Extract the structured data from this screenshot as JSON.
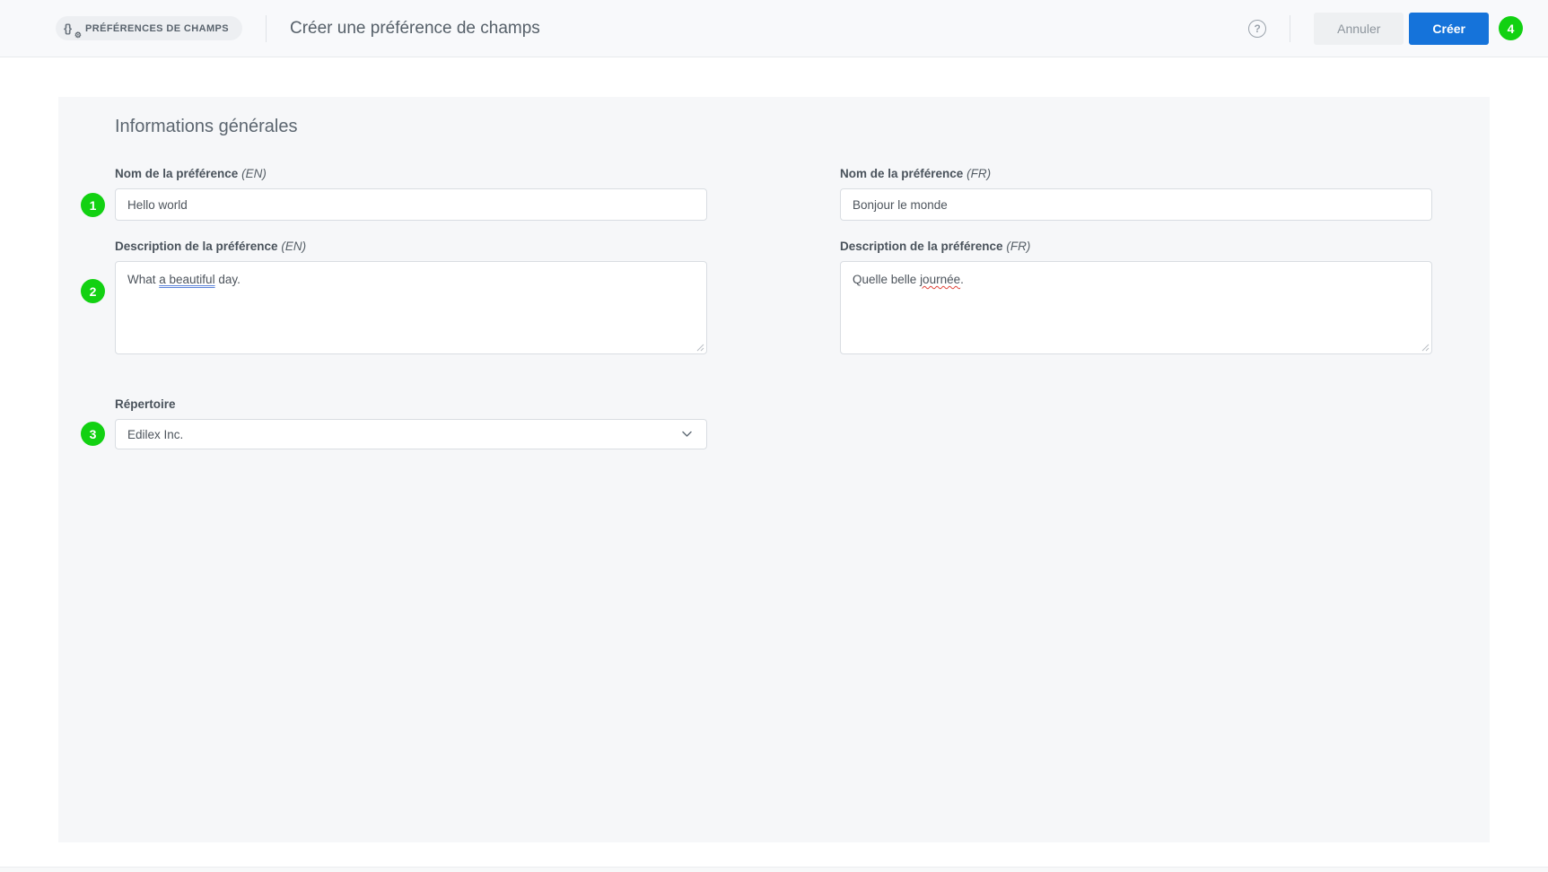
{
  "header": {
    "module_badge": {
      "label": "PRÉFÉRENCES DE CHAMPS",
      "icon": "braces-gear-icon"
    },
    "title": "Créer une préférence de champs",
    "help_icon_glyph": "?",
    "cancel_label": "Annuler",
    "create_label": "Créer",
    "step_badge": "4"
  },
  "colors": {
    "accent_blue": "#1573da",
    "annotation_green": "#12d112",
    "grammar_underline_blue": "#5b82d8",
    "spell_underline_red": "#e0443a",
    "panel_background": "#f6f7f9",
    "header_background": "#f8f9fb"
  },
  "section": {
    "title": "Informations générales",
    "fields": {
      "name_en": {
        "label": "Nom de la préférence",
        "lang": "(EN)",
        "value": "Hello world",
        "badge": "1"
      },
      "name_fr": {
        "label": "Nom de la préférence",
        "lang": "(FR)",
        "value": "Bonjour le monde"
      },
      "desc_en": {
        "label": "Description de la préférence",
        "lang": "(EN)",
        "badge": "2",
        "parts": [
          {
            "text": "What "
          },
          {
            "text": "a beautiful",
            "mark": "grammar"
          },
          {
            "text": " day."
          }
        ]
      },
      "desc_fr": {
        "label": "Description de la préférence",
        "lang": "(FR)",
        "parts": [
          {
            "text": "Quelle belle "
          },
          {
            "text": "journée",
            "mark": "spell"
          },
          {
            "text": "."
          }
        ]
      },
      "repertoire": {
        "label": "Répertoire",
        "value": "Edilex Inc.",
        "badge": "3",
        "chevron_icon": "chevron-down-icon"
      }
    }
  }
}
